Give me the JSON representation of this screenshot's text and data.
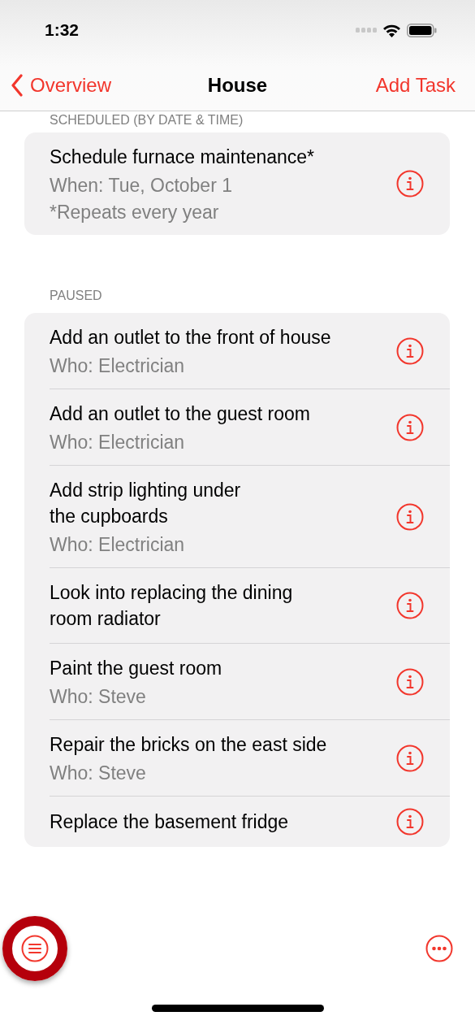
{
  "status_bar": {
    "time": "1:32"
  },
  "nav": {
    "back": "Overview",
    "title": "House",
    "action": "Add Task"
  },
  "sections": [
    {
      "header": "SCHEDULED (BY DATE & TIME)",
      "rows": [
        {
          "title": "Schedule furnace maintenance*",
          "details": [
            "When: Tue, October 1",
            "*Repeats every year"
          ]
        }
      ]
    },
    {
      "header": "PAUSED",
      "rows": [
        {
          "title": "Add an outlet to the front of house",
          "details": [
            "Who: Electrician"
          ]
        },
        {
          "title": "Add an outlet to the guest room",
          "details": [
            "Who: Electrician"
          ]
        },
        {
          "title": "Add strip lighting under\nthe cupboards",
          "details": [
            "Who: Electrician"
          ]
        },
        {
          "title": "Look into replacing the dining\nroom radiator",
          "details": []
        },
        {
          "title": "Paint the guest room",
          "details": [
            "Who: Steve"
          ]
        },
        {
          "title": "Repair the bricks on the east side",
          "details": [
            "Who: Steve"
          ]
        },
        {
          "title": "Replace the basement fridge",
          "details": []
        }
      ]
    }
  ],
  "toolbar": {
    "menu_highlighted": true
  }
}
